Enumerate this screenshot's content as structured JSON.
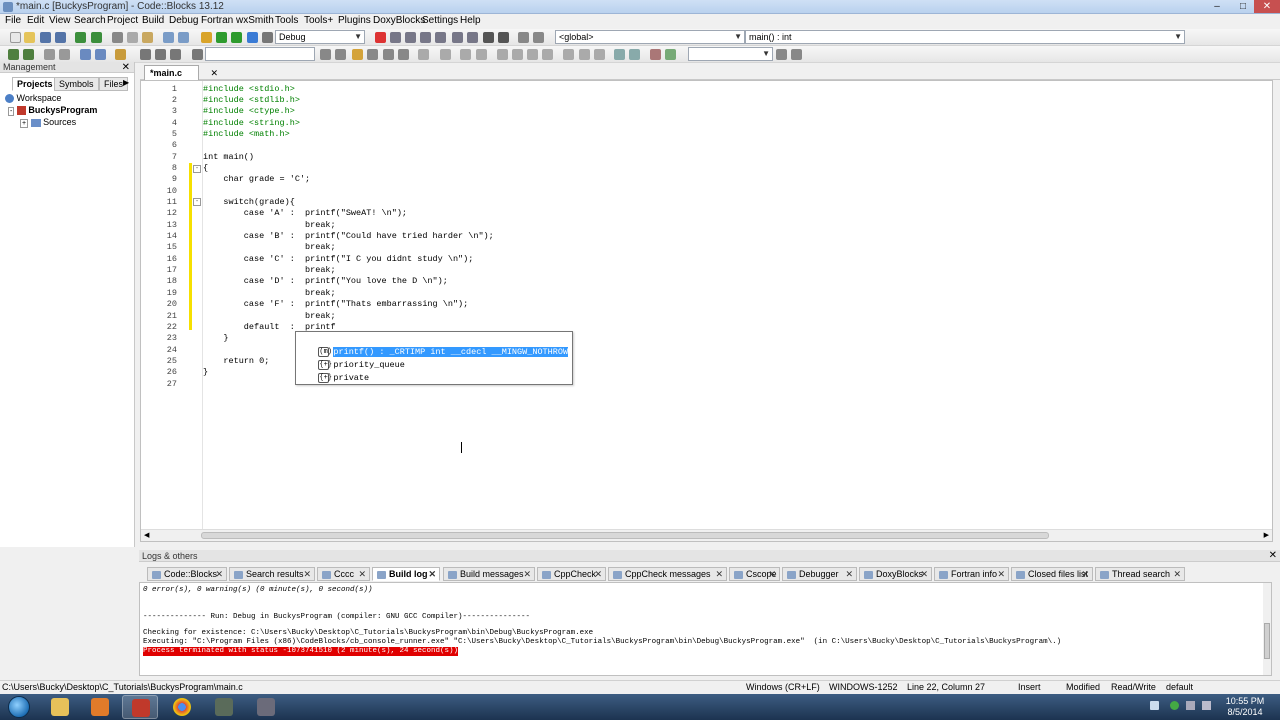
{
  "window": {
    "title": "*main.c [BuckysProgram] - Code::Blocks 13.12"
  },
  "menu": [
    "File",
    "Edit",
    "View",
    "Search",
    "Project",
    "Build",
    "Debug",
    "Fortran",
    "wxSmith",
    "Tools",
    "Tools+",
    "Plugins",
    "DoxyBlocks",
    "Settings",
    "Help"
  ],
  "toolbar": {
    "build_target": "Debug",
    "scope": "<global>",
    "function": "main() : int"
  },
  "management": {
    "title": "Management",
    "tabs": [
      "Projects",
      "Symbols",
      "Files"
    ],
    "tree": [
      "Workspace",
      "BuckysProgram",
      "Sources"
    ]
  },
  "editor": {
    "tab": "*main.c",
    "lines": [
      {
        "n": "1",
        "code": "#include <stdio.h>",
        "cls": "pp"
      },
      {
        "n": "2",
        "code": "#include <stdlib.h>",
        "cls": "pp"
      },
      {
        "n": "3",
        "code": "#include <ctype.h>",
        "cls": "pp"
      },
      {
        "n": "4",
        "code": "#include <string.h>",
        "cls": "pp"
      },
      {
        "n": "5",
        "code": "#include <math.h>",
        "cls": "pp"
      },
      {
        "n": "6",
        "code": "",
        "cls": ""
      },
      {
        "n": "7",
        "code": "int main()",
        "cls": ""
      },
      {
        "n": "8",
        "code": "{",
        "cls": ""
      },
      {
        "n": "9",
        "code": "    char grade = 'C';",
        "cls": ""
      },
      {
        "n": "10",
        "code": "",
        "cls": ""
      },
      {
        "n": "11",
        "code": "    switch(grade){",
        "cls": ""
      },
      {
        "n": "12",
        "code": "        case 'A' :  printf(\"SweAT! \\n\");",
        "cls": ""
      },
      {
        "n": "13",
        "code": "                    break;",
        "cls": ""
      },
      {
        "n": "14",
        "code": "        case 'B' :  printf(\"Could have tried harder \\n\");",
        "cls": ""
      },
      {
        "n": "15",
        "code": "                    break;",
        "cls": ""
      },
      {
        "n": "16",
        "code": "        case 'C' :  printf(\"I C you didnt study \\n\");",
        "cls": ""
      },
      {
        "n": "17",
        "code": "                    break;",
        "cls": ""
      },
      {
        "n": "18",
        "code": "        case 'D' :  printf(\"You love the D \\n\");",
        "cls": ""
      },
      {
        "n": "19",
        "code": "                    break;",
        "cls": ""
      },
      {
        "n": "20",
        "code": "        case 'F' :  printf(\"Thats embarrassing \\n\");",
        "cls": ""
      },
      {
        "n": "21",
        "code": "                    break;",
        "cls": ""
      },
      {
        "n": "22",
        "code": "        default  :  printf",
        "cls": ""
      },
      {
        "n": "23",
        "code": "    }",
        "cls": ""
      },
      {
        "n": "24",
        "code": "",
        "cls": ""
      },
      {
        "n": "25",
        "code": "    return 0;",
        "cls": ""
      },
      {
        "n": "26",
        "code": "}",
        "cls": ""
      },
      {
        "n": "27",
        "code": "",
        "cls": ""
      }
    ]
  },
  "autocomplete": [
    {
      "icon": "(m)",
      "text": "printf() : _CRTIMP int __cdecl __MINGW_NOTHROW",
      "selected": true
    },
    {
      "icon": "{+}",
      "text": "priority_queue",
      "selected": false
    },
    {
      "icon": "{+}",
      "text": "private",
      "selected": false
    }
  ],
  "logs": {
    "title": "Logs & others",
    "tabs": [
      "Code::Blocks",
      "Search results",
      "Cccc",
      "Build log",
      "Build messages",
      "CppCheck",
      "CppCheck messages",
      "Cscope",
      "Debugger",
      "DoxyBlocks",
      "Fortran info",
      "Closed files list",
      "Thread search"
    ],
    "active_tab": "Build log",
    "lines": [
      "0 error(s), 0 warning(s) (0 minute(s), 0 second(s))",
      "",
      "-------------- Run: Debug in BuckysProgram (compiler: GNU GCC Compiler)---------------",
      "",
      "Checking for existence: C:\\Users\\Bucky\\Desktop\\C_Tutorials\\BuckysProgram\\bin\\Debug\\BuckysProgram.exe",
      "Executing: \"C:\\Program Files (x86)\\CodeBlocks/cb_console_runner.exe\" \"C:\\Users\\Bucky\\Desktop\\C_Tutorials\\BuckysProgram\\bin\\Debug\\BuckysProgram.exe\"  (in C:\\Users\\Bucky\\Desktop\\C_Tutorials\\BuckysProgram\\.)"
    ],
    "error_line": "Process terminated with status -1073741510 (2 minute(s), 24 second(s))"
  },
  "status": {
    "path": "C:\\Users\\Bucky\\Desktop\\C_Tutorials\\BuckysProgram\\main.c",
    "eol": "Windows (CR+LF)",
    "encoding": "WINDOWS-1252",
    "position": "Line 22, Column 27",
    "mode": "Insert",
    "modified": "Modified",
    "access": "Read/Write",
    "lang": "default"
  },
  "taskbar": {
    "time": "10:55 PM",
    "date": "8/5/2014"
  },
  "colors": {
    "selection": "#3399ff",
    "error_bg": "#e00000",
    "preprocessor": "#008000"
  }
}
